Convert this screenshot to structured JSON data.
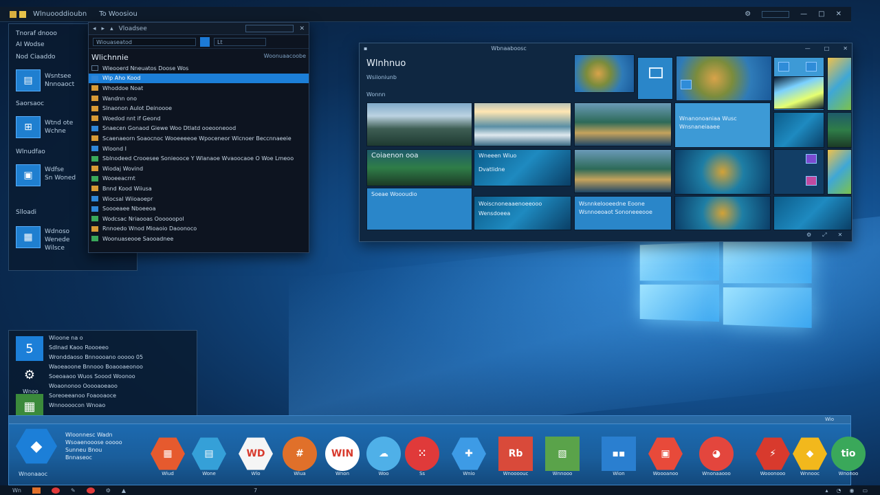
{
  "topbar": {
    "title": "Wlnuooddioubn",
    "subtitle": "To Woosiou"
  },
  "side_panel": {
    "items": [
      "Tnoraf dnooo",
      "AI   Wodse",
      "Nod Ciaaddo",
      "Wsntsee",
      "Nnnoaoct",
      "Saorsaoc",
      "Wtnd ote",
      "Wchne",
      "Wlnudfao",
      "Wdfse",
      "Sn Woned",
      "Slloadi",
      "Wdnoso",
      "Wenede",
      "Wilsce"
    ]
  },
  "explorer": {
    "title": "Vloadsee",
    "address": "Wiouaseatod",
    "address2": "Lt",
    "heading": "Wlichnnie",
    "heading_right": "Woonuaacoobe",
    "rows": [
      "Wleooerd Nneuatos Doose Wos",
      "Wlp Aho Kood",
      "Whoddoe Noat",
      "Wandnn ono",
      "Slnaonon Aulot Deinoooe",
      "Woedod nnt if Geond",
      "Snaecen Gonaod Giewe Woo Dtlatd ooeooneood",
      "Scaenaeorn Soaocnoc Wooeeeeoe Wpoceneor Wlcnoer Beccnnaeeie",
      "Wloond I",
      "Sblnodeed Crooesee Sonieooce Y  Wlanaoe Wvaoocaoe O Woe Lmeoo",
      "Wiodaj Wovind",
      "Wooeeacrnt",
      "Bnnd  Kood  Wiiusa",
      "Wiocsal  Wiioaoepr",
      "Soooeaee  Nboeeoa",
      "Wodcsac Nriaooas Oooooopol",
      "Rnnoedo  Wnod  Mioaoio Daoonoco",
      "Woonuaseooe Saooadnee"
    ]
  },
  "gallery": {
    "title": "Wbnaaboosc",
    "heading": "Wlnhnuo",
    "sub1": "Wsiioniunb",
    "sub2": "Wonnn",
    "tiles": [
      "Wnanonoaniaa Wusc",
      "Wnsnaneiaaee",
      "Coiaenon ooa",
      "Wneeen Wiuo",
      "Dvatlidne",
      "Soeae Woooudio",
      "Woiscnoneaaenoeeooo",
      "Wensdoeea",
      "Wsnnkelooeedne Eoone",
      "Wsnnoeoaot Sononeeeooe"
    ]
  },
  "bottom_panel": {
    "lines": [
      "Wioone na o",
      "Sdlnad Kaoo  Roooeeo",
      "Wronddaoso Bnnoooano ooooo 05",
      "Waoeaoone Bnnooo Boaooaeonoo",
      "Soeoaaoo Wuos Soood Woonoo",
      "Woaononoo Ooooaoeaoo",
      "Soreoeeanoo Foaooaoce",
      "Wnnoooocon Wnoao"
    ],
    "footer": "Wnoo"
  },
  "dock": {
    "strip": "Wio",
    "hero_title": "Wloonnesc Wadn",
    "hero_lines": [
      "Wsoaenooose ooooo",
      "Sunneu Bnou",
      "Bnnaseoc"
    ],
    "hero_foot": "Wnonaaoc",
    "apps": [
      {
        "label": "Wiud",
        "glyph": "▦",
        "color": "#e65a2e",
        "shape": "hex"
      },
      {
        "label": "Wone",
        "glyph": "▤",
        "color": "#35a0d8",
        "shape": "hex"
      },
      {
        "label": "Wlo",
        "glyph": "WD",
        "color": "#f5f5f5",
        "shape": "hex"
      },
      {
        "label": "Wiua",
        "glyph": "#",
        "color": "#e0702a",
        "shape": "circle"
      },
      {
        "label": "Wnon",
        "glyph": "WIN",
        "color": "#ffffff",
        "shape": "circle"
      },
      {
        "label": "Woo",
        "glyph": "☁",
        "color": "#4fb0e8",
        "shape": "circle"
      },
      {
        "label": "Ss",
        "glyph": "⁙",
        "color": "#e03a3a",
        "shape": "circle"
      },
      {
        "label": "Wnio",
        "glyph": "✚",
        "color": "#3d9be6",
        "shape": "hex"
      },
      {
        "label": "Wnoooouc",
        "glyph": "Rb",
        "color": "#d94a3a",
        "shape": "square"
      },
      {
        "label": "Wnnooo",
        "glyph": "▧",
        "color": "#5aa34a",
        "shape": "square"
      },
      {
        "label": "Wion",
        "glyph": "▪▪",
        "color": "#2a7fd0",
        "shape": "square"
      },
      {
        "label": "Woooanoo",
        "glyph": "▣",
        "color": "#e84a3a",
        "shape": "hex"
      },
      {
        "label": "Wnonaaooo",
        "glyph": "◕",
        "color": "#e3463d",
        "shape": "circle"
      },
      {
        "label": "Wooonooo",
        "glyph": "⚡",
        "color": "#d83a2d",
        "shape": "hex"
      },
      {
        "label": "Wnnooc",
        "glyph": "◆",
        "color": "#f2b81c",
        "shape": "hex"
      },
      {
        "label": "Wnonoo",
        "glyph": "tio",
        "color": "#3aa85a",
        "shape": "circle"
      }
    ]
  },
  "taskbar": {
    "left": "Wn",
    "clock": "7"
  }
}
